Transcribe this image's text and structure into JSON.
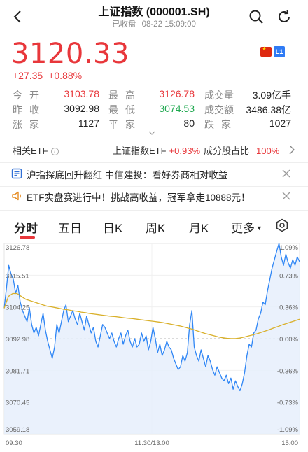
{
  "header": {
    "title": "上证指数 (000001.SH)",
    "status": "已收盘",
    "datetime": "08-22 15:09:00"
  },
  "quote": {
    "price": "3120.33",
    "change": "+27.35",
    "change_pct": "+0.88%",
    "level_badge": "L1"
  },
  "stats": [
    [
      {
        "label": "今开",
        "value": "3103.78",
        "color": "red"
      },
      {
        "label": "最高",
        "value": "3126.78",
        "color": "red"
      },
      {
        "label": "成交量",
        "value": "3.09亿手",
        "color": ""
      }
    ],
    [
      {
        "label": "昨收",
        "value": "3092.98",
        "color": ""
      },
      {
        "label": "最低",
        "value": "3074.53",
        "color": "green"
      },
      {
        "label": "成交额",
        "value": "3486.38亿",
        "color": ""
      }
    ],
    [
      {
        "label": "涨家",
        "value": "1127",
        "color": ""
      },
      {
        "label": "平家",
        "value": "80",
        "color": ""
      },
      {
        "label": "跌家",
        "value": "1027",
        "color": ""
      }
    ]
  ],
  "etf_bar": {
    "related_label": "相关ETF",
    "etf_name": "上证指数ETF",
    "etf_pct": "+0.93%",
    "share_label": "成分股占比",
    "share_pct": "100%"
  },
  "news": [
    {
      "text": "沪指探底回升翻红 中信建投：看好券商相对收益"
    },
    {
      "text": "ETF实盘赛进行中！挑战高收益，冠军拿走10888元！"
    }
  ],
  "tabs": [
    "分时",
    "五日",
    "日K",
    "周K",
    "月K",
    "更多"
  ],
  "colors": {
    "up": "#e8373b",
    "down": "#1ea84f",
    "price_line": "#2f86f5",
    "avg_line": "#d9b02a",
    "fill": "#e6eefc"
  },
  "chart_data": {
    "type": "line",
    "y_ticks": [
      "3126.78",
      "3115.51",
      "3104.25",
      "3092.98",
      "3081.71",
      "3070.45",
      "3059.18"
    ],
    "pct_ticks": [
      "1.09%",
      "0.73%",
      "0.36%",
      "0.00%",
      "-0.36%",
      "-0.73%",
      "-1.09%"
    ],
    "x_ticks": [
      "09:30",
      "11:30/13:00",
      "15:00"
    ],
    "ylim": [
      3059.18,
      3126.78
    ],
    "reference": 3092.98,
    "series": [
      {
        "values": [
          3103.8,
          3111,
          3119,
          3116,
          3114,
          3109,
          3112,
          3106,
          3103,
          3101,
          3099,
          3104,
          3098,
          3095,
          3097,
          3094,
          3098,
          3102,
          3096,
          3092,
          3089,
          3086,
          3090,
          3098,
          3095,
          3099,
          3103,
          3105,
          3099,
          3101,
          3103,
          3100,
          3098,
          3102,
          3099,
          3096,
          3101,
          3098,
          3095,
          3097,
          3092,
          3090,
          3094,
          3098,
          3097,
          3095,
          3093,
          3095,
          3092,
          3090,
          3093,
          3095,
          3091,
          3094,
          3096,
          3092,
          3090,
          3093,
          3090,
          3091,
          3095,
          3092,
          3094,
          3089,
          3092,
          3097,
          3093,
          3088,
          3091,
          3087,
          3089,
          3092,
          3090,
          3089,
          3086,
          3084,
          3082,
          3083,
          3087,
          3085,
          3088,
          3098,
          3103,
          3090,
          3087,
          3085,
          3089,
          3086,
          3083,
          3087,
          3085,
          3082,
          3080,
          3083,
          3081,
          3079,
          3078,
          3080,
          3077,
          3079,
          3075,
          3078,
          3076,
          3074.5,
          3077,
          3081,
          3087,
          3091,
          3090,
          3095,
          3096,
          3100,
          3102,
          3106,
          3105,
          3110,
          3114,
          3118,
          3121,
          3124,
          3126.8,
          3122,
          3119,
          3123,
          3120,
          3118,
          3121,
          3119,
          3122,
          3120.33
        ]
      },
      {
        "values": [
          3103.8,
          3108,
          3109,
          3109,
          3108,
          3107,
          3106.5,
          3106,
          3105.5,
          3105,
          3104.5,
          3104.3,
          3104,
          3103.7,
          3103.4,
          3103.2,
          3102.9,
          3102.7,
          3102.4,
          3102.2,
          3101.9,
          3101.7,
          3101.5,
          3101.3,
          3101.1,
          3100.9,
          3100.8,
          3100.6,
          3100.4,
          3100.2,
          3100.1,
          3099.9,
          3099.7,
          3099.5,
          3099.3,
          3099.1,
          3098.9,
          3098.7,
          3098.4,
          3098.1,
          3097.8,
          3097.5,
          3097.1,
          3096.7,
          3096.3,
          3095.8,
          3095.3,
          3094.8,
          3094.4,
          3094,
          3093.6,
          3093.3,
          3093.1,
          3093,
          3093,
          3093.2,
          3093.5,
          3093.9,
          3094.3,
          3094.7,
          3095.2,
          3095.7,
          3096.2,
          3096.8,
          3097.3,
          3097.9,
          3098.4,
          3098.9,
          3099.4,
          3099.9
        ]
      }
    ]
  }
}
